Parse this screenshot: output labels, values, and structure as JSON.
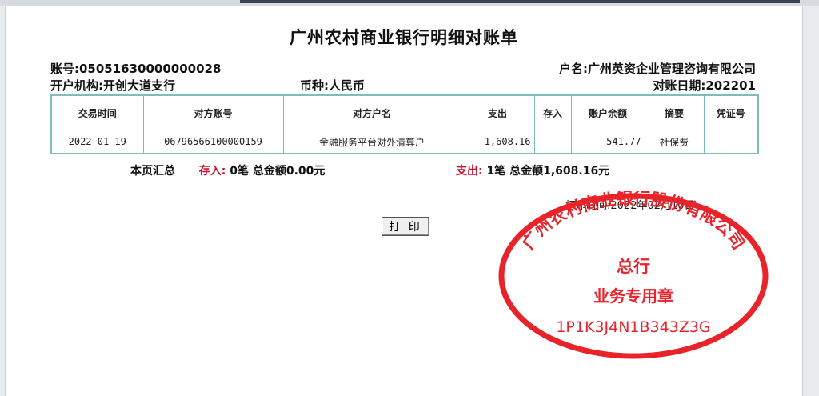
{
  "document": {
    "title": "广州农村商业银行明细对账单",
    "account_label": "账号:",
    "account_number": "05051630000000028",
    "account_name_label": "户名:",
    "account_name": "广州英资企业管理咨询有限公司",
    "branch_label": "开户机构:",
    "branch": "开创大道支行",
    "currency_label": "币种:",
    "currency": "人民币",
    "date_label": "对账日期:",
    "statement_date": "202201"
  },
  "table": {
    "headers": [
      "交易时间",
      "对方账号",
      "对方户名",
      "支出",
      "存入",
      "账户余额",
      "摘要",
      "凭证号"
    ],
    "rows": [
      [
        "2022-01-19",
        "06796566100000159",
        "金融服务平台对外清算户",
        "1,608.16",
        "",
        "541.77",
        "社保费",
        ""
      ]
    ]
  },
  "summary": {
    "page_label": "本页汇总",
    "deposit_label": "存入:",
    "deposit_text": "0笔 总金额0.00元",
    "expense_label": "支出:",
    "expense_text": "1笔 总金额1,608.16元"
  },
  "print": {
    "time_label": "打印时间:",
    "time_value": "2022年02月10日",
    "button_label": "打 印"
  },
  "seal": {
    "arc_text": "广州农村商业银行股份有限公司",
    "line1": "总行",
    "line2": "业务专用章",
    "code": "1P1K3J4N1B343Z3G",
    "color": "#e8232a"
  }
}
